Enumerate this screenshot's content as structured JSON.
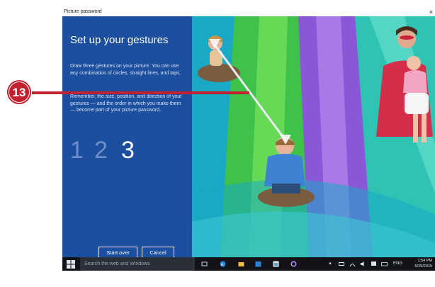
{
  "window": {
    "title": "Picture password",
    "close": "×"
  },
  "panel": {
    "heading": "Set up your gestures",
    "para1": "Draw three gestures on your picture. You can use any combination of circles, straight lines, and taps.",
    "para2": "Remember, the size, position, and direction of your gestures — and the order in which you make them — become part of your picture password.",
    "steps": [
      "1",
      "2",
      "3"
    ],
    "start_over": "Start over",
    "cancel": "Cancel"
  },
  "callout": {
    "number": "13"
  },
  "taskbar": {
    "search_placeholder": "Search the web and Windows",
    "language": "ENG",
    "time": "1:54 PM",
    "date": "5/29/2015"
  },
  "colors": {
    "panel": "#1d4f9f",
    "callout": "#c0232f",
    "gesture_line": "#e8e8f0"
  }
}
